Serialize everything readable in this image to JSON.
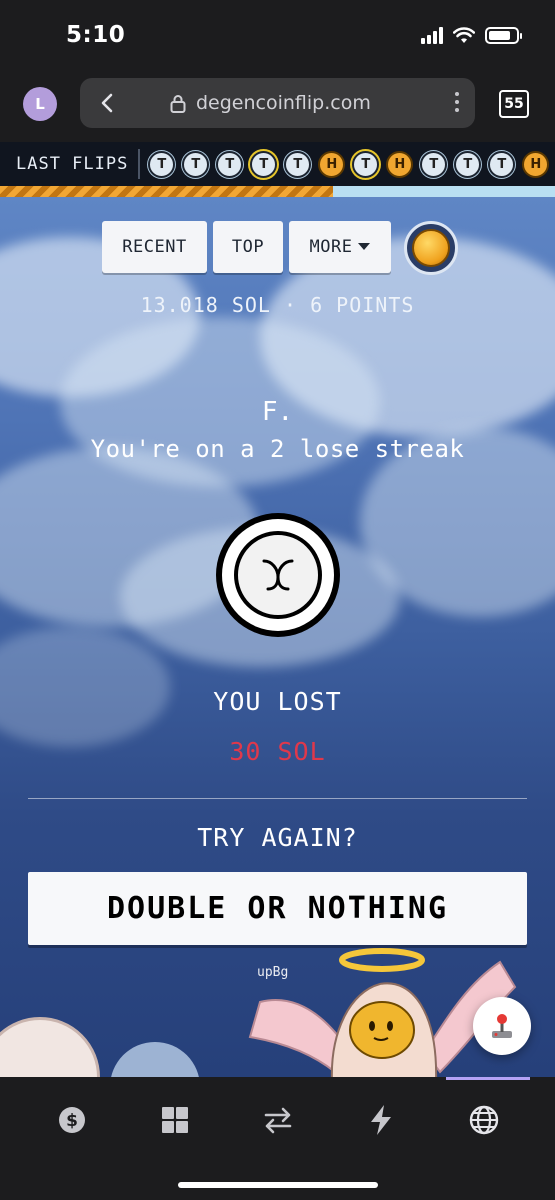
{
  "status_bar": {
    "time": "5:10"
  },
  "browser": {
    "profile_initial": "L",
    "url": "degencoinflip.com",
    "tab_count": "55"
  },
  "last_flips": {
    "label": "LAST FLIPS",
    "items": [
      {
        "side": "T",
        "ring": false
      },
      {
        "side": "T",
        "ring": false
      },
      {
        "side": "T",
        "ring": false
      },
      {
        "side": "T",
        "ring": true
      },
      {
        "side": "T",
        "ring": false
      },
      {
        "side": "H",
        "ring": false
      },
      {
        "side": "T",
        "ring": true
      },
      {
        "side": "H",
        "ring": false
      },
      {
        "side": "T",
        "ring": false
      },
      {
        "side": "T",
        "ring": false
      },
      {
        "side": "T",
        "ring": false
      },
      {
        "side": "H",
        "ring": false
      }
    ],
    "progress_fraction": 0.6
  },
  "tabs": {
    "recent": "RECENT",
    "top": "TOP",
    "more": "MORE"
  },
  "stats": "13.018 SOL · 6 POINTS",
  "message": {
    "title": "F.",
    "streak": "You're on a 2 lose streak"
  },
  "result": {
    "label": "YOU LOST",
    "amount": "30 SOL"
  },
  "retry": {
    "prompt": "TRY AGAIN?",
    "button": "DOUBLE OR NOTHING"
  },
  "tiny_label": "upBg",
  "colors": {
    "loss": "#e0384b",
    "heads": "#f0a630",
    "tails": "#dfe9f2",
    "nav_accent": "#b5a3f5"
  },
  "bottom_nav": [
    "dollar-icon",
    "grid-icon",
    "swap-icon",
    "lightning-icon",
    "globe-icon"
  ]
}
